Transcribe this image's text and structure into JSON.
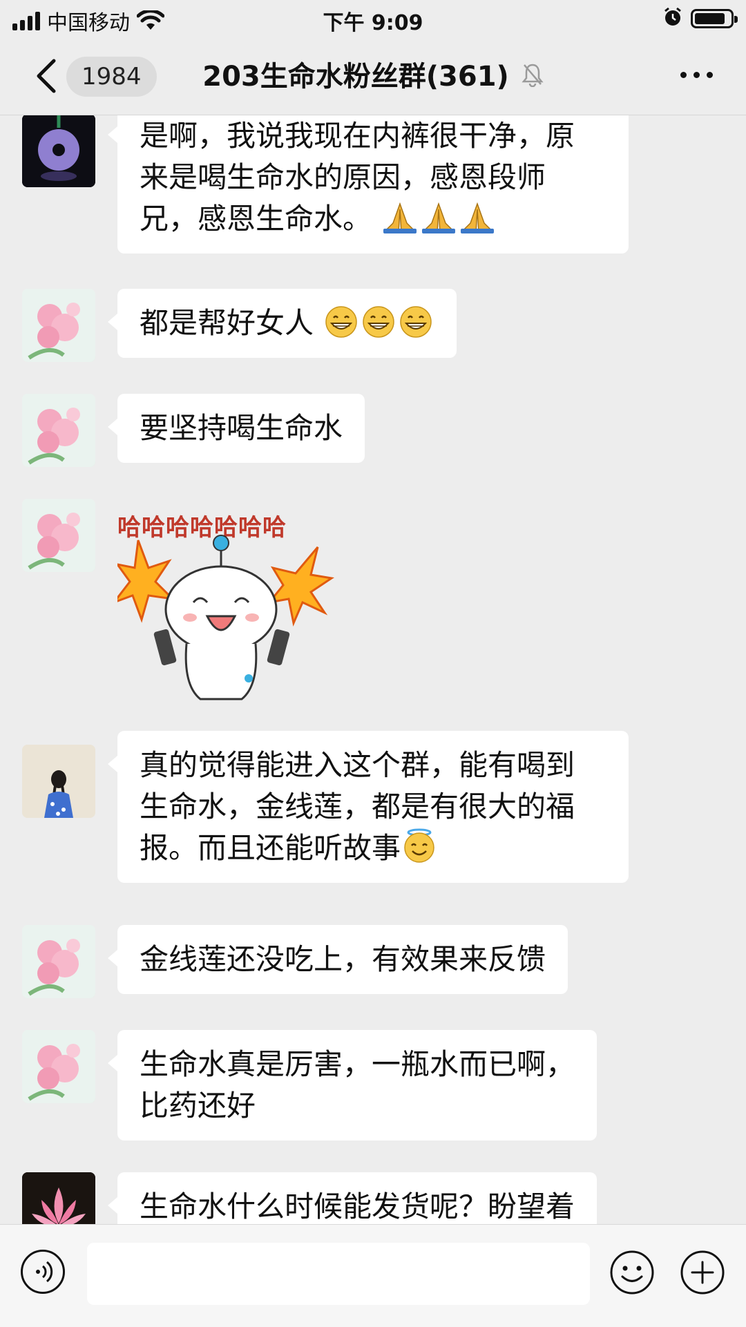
{
  "status_bar": {
    "carrier": "中国移动",
    "time": "下午 9:09",
    "battery_level": 0.85
  },
  "nav": {
    "back_count": "1984",
    "title": "203生命水粉丝群(361)",
    "mute": true
  },
  "messages": [
    {
      "avatar": "jade-pendant-avatar",
      "lines": [
        "是啊，我说我现在内裤很干净，原",
        "来是喝生命水的原因，感恩段师",
        "兄，感恩生命水。"
      ],
      "emoji": "folded-hands",
      "emoji_count": 3
    },
    {
      "avatar": "pink-flower-avatar",
      "lines": [
        "都是帮好女人"
      ],
      "emoji": "grinning-face",
      "emoji_count": 3
    },
    {
      "avatar": "pink-flower-avatar",
      "lines": [
        "要坚持喝生命水"
      ]
    },
    {
      "avatar": "pink-flower-avatar",
      "sticker": {
        "caption": "哈哈哈哈哈哈哈",
        "icon": "cartoon-laughing-sticker"
      }
    },
    {
      "avatar": "girl-back-avatar",
      "lines": [
        "真的觉得能进入这个群，能有喝到",
        "生命水，金线莲，都是有很大的福",
        "报。而且还能听故事"
      ],
      "emoji": "smiling-face-with-halo",
      "emoji_count": 1
    },
    {
      "avatar": "pink-flower-avatar",
      "lines": [
        "金线莲还没吃上，有效果来反馈"
      ]
    },
    {
      "avatar": "pink-flower-avatar",
      "lines": [
        "生命水真是厉害，一瓶水而已啊，",
        "比药还好"
      ]
    },
    {
      "avatar": "lotus-avatar",
      "lines": [
        "生命水什么时候能发货呢？盼望着"
      ]
    }
  ],
  "input_bar": {
    "placeholder": "",
    "icons": [
      "voice-icon",
      "emoji-icon",
      "plus-icon"
    ]
  }
}
